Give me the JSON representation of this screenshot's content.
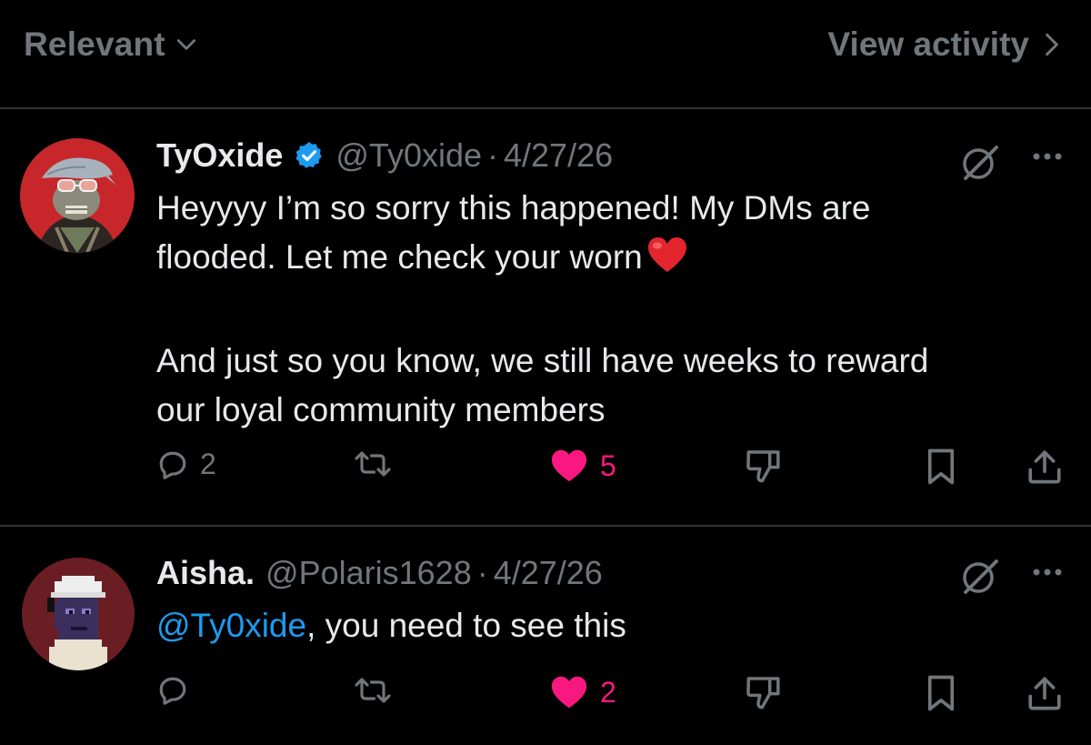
{
  "topbar": {
    "sort_label": "Relevant",
    "view_activity_label": "View activity"
  },
  "tweets": [
    {
      "display_name": "TyOxide",
      "verified": true,
      "handle": "@Ty0xide",
      "separator": "·",
      "date": "4/27/26",
      "body": {
        "line1": "Heyyyy I’m so sorry this happened! My DMs are",
        "line2": "flooded. Let me check your worn",
        "emoji": "red-heart",
        "line3": "And just so you know, we still have weeks to reward",
        "line4": "our loyal community members"
      },
      "actions": {
        "replies": "2",
        "reposts": "",
        "likes": "5",
        "liked": true
      }
    },
    {
      "display_name": "Aisha.",
      "verified": false,
      "handle": "@Polaris1628",
      "separator": "·",
      "date": "4/27/26",
      "body": {
        "mention": "@Ty0xide",
        "text": ", you need to see this"
      },
      "actions": {
        "replies": "",
        "reposts": "",
        "likes": "2",
        "liked": true
      }
    }
  ],
  "colors": {
    "background": "#000000",
    "text": "#e7e9ea",
    "secondary": "#71767b",
    "divider": "#2f3336",
    "link": "#1d9bf0",
    "like": "#f91880",
    "verified": "#1d9bf0"
  },
  "icons": [
    "chevron-down-icon",
    "chevron-right-icon",
    "verified-badge-icon",
    "grok-icon",
    "more-icon",
    "reply-icon",
    "repost-icon",
    "like-icon",
    "dislike-icon",
    "bookmark-icon",
    "share-icon"
  ]
}
